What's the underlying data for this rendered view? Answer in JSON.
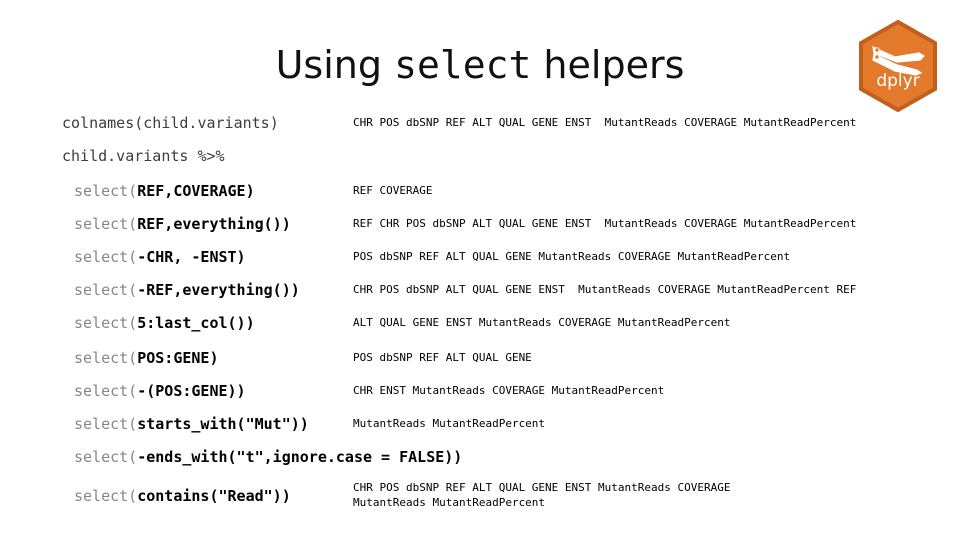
{
  "title": {
    "part1": "Using ",
    "code": "select",
    "part2": " helpers"
  },
  "logo": {
    "name": "dplyr",
    "hex_fill": "#E3792B",
    "hex_border": "#C0601C",
    "text_color": "#FFFFFF"
  },
  "colors": {
    "prefix_gray": "#878787",
    "args_black": "#000000",
    "background": "#FFFFFF"
  },
  "rows": [
    {
      "code_prefix": "colnames(child.variants)",
      "code_args": "",
      "style": "plain",
      "output": [
        "CHR POS dbSNP REF ALT QUAL GENE ENST  MutantReads COVERAGE MutantReadPercent"
      ]
    },
    {
      "code_prefix": "child.variants %>%",
      "code_args": "",
      "style": "plain",
      "output": []
    },
    {
      "code_prefix": "select(",
      "code_args": "REF,COVERAGE)",
      "style": "call",
      "output": [
        "REF COVERAGE"
      ]
    },
    {
      "code_prefix": "select(",
      "code_args": "REF,everything())",
      "style": "call",
      "output": [
        "REF CHR POS dbSNP ALT QUAL GENE ENST  MutantReads COVERAGE MutantReadPercent"
      ]
    },
    {
      "code_prefix": "select(",
      "code_args": "-CHR, -ENST)",
      "style": "call",
      "output": [
        "POS dbSNP REF ALT QUAL GENE MutantReads COVERAGE MutantReadPercent"
      ]
    },
    {
      "code_prefix": "select(",
      "code_args": "-REF,everything())",
      "style": "call",
      "output": [
        "CHR POS dbSNP ALT QUAL GENE ENST  MutantReads COVERAGE MutantReadPercent REF"
      ]
    },
    {
      "code_prefix": "select(",
      "code_args": "5:last_col())",
      "style": "call",
      "output": [
        "ALT QUAL GENE ENST MutantReads COVERAGE MutantReadPercent"
      ]
    },
    {
      "code_prefix": "select(",
      "code_args": "POS:GENE)",
      "style": "call",
      "output": [
        "POS dbSNP REF ALT QUAL GENE"
      ]
    },
    {
      "code_prefix": "select(",
      "code_args": "-(POS:GENE))",
      "style": "call",
      "output": [
        "CHR ENST MutantReads COVERAGE MutantReadPercent"
      ]
    },
    {
      "code_prefix": "select(",
      "code_args": "starts_with(\"Mut\"))",
      "style": "call",
      "output": [
        "MutantReads MutantReadPercent"
      ]
    },
    {
      "code_prefix": "select(",
      "code_args": "-ends_with(\"t\",ignore.case = FALSE))",
      "style": "call",
      "output": []
    },
    {
      "code_prefix": "select(",
      "code_args": "contains(\"Read\"))",
      "style": "call",
      "output": [
        "CHR POS dbSNP REF ALT QUAL GENE ENST MutantReads COVERAGE",
        "MutantReads MutantReadPercent"
      ]
    }
  ]
}
